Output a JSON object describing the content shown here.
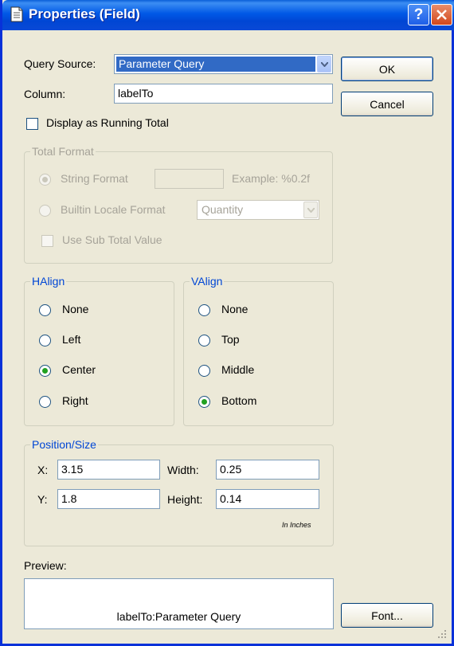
{
  "window": {
    "title": "Properties (Field)"
  },
  "query_source": {
    "label": "Query Source:",
    "selected": "Parameter Query"
  },
  "column": {
    "label": "Column:",
    "value": "labelTo"
  },
  "running_total": {
    "label": "Display as Running Total",
    "checked": false
  },
  "total_format": {
    "legend": "Total Format",
    "string_format_label": "String Format",
    "string_format_value": "",
    "example": "Example: %0.2f",
    "builtin_label": "Builtin Locale Format",
    "builtin_selected": "Quantity",
    "use_subtotal_label": "Use Sub Total Value"
  },
  "halign": {
    "legend": "HAlign",
    "options": [
      "None",
      "Left",
      "Center",
      "Right"
    ],
    "selected": "Center"
  },
  "valign": {
    "legend": "VAlign",
    "options": [
      "None",
      "Top",
      "Middle",
      "Bottom"
    ],
    "selected": "Bottom"
  },
  "position_size": {
    "legend": "Position/Size",
    "x_label": "X:",
    "x_value": "3.15",
    "y_label": "Y:",
    "y_value": "1.8",
    "width_label": "Width:",
    "width_value": "0.25",
    "height_label": "Height:",
    "height_value": "0.14",
    "units_note": "In Inches"
  },
  "preview": {
    "label": "Preview:",
    "text": "labelTo:Parameter Query"
  },
  "buttons": {
    "ok": "OK",
    "cancel": "Cancel",
    "font": "Font..."
  },
  "colors": {
    "title_bar": "#0058e6",
    "selection": "#316ac5",
    "group_legend": "#0046d5",
    "dialog_bg": "#ece9d8"
  }
}
